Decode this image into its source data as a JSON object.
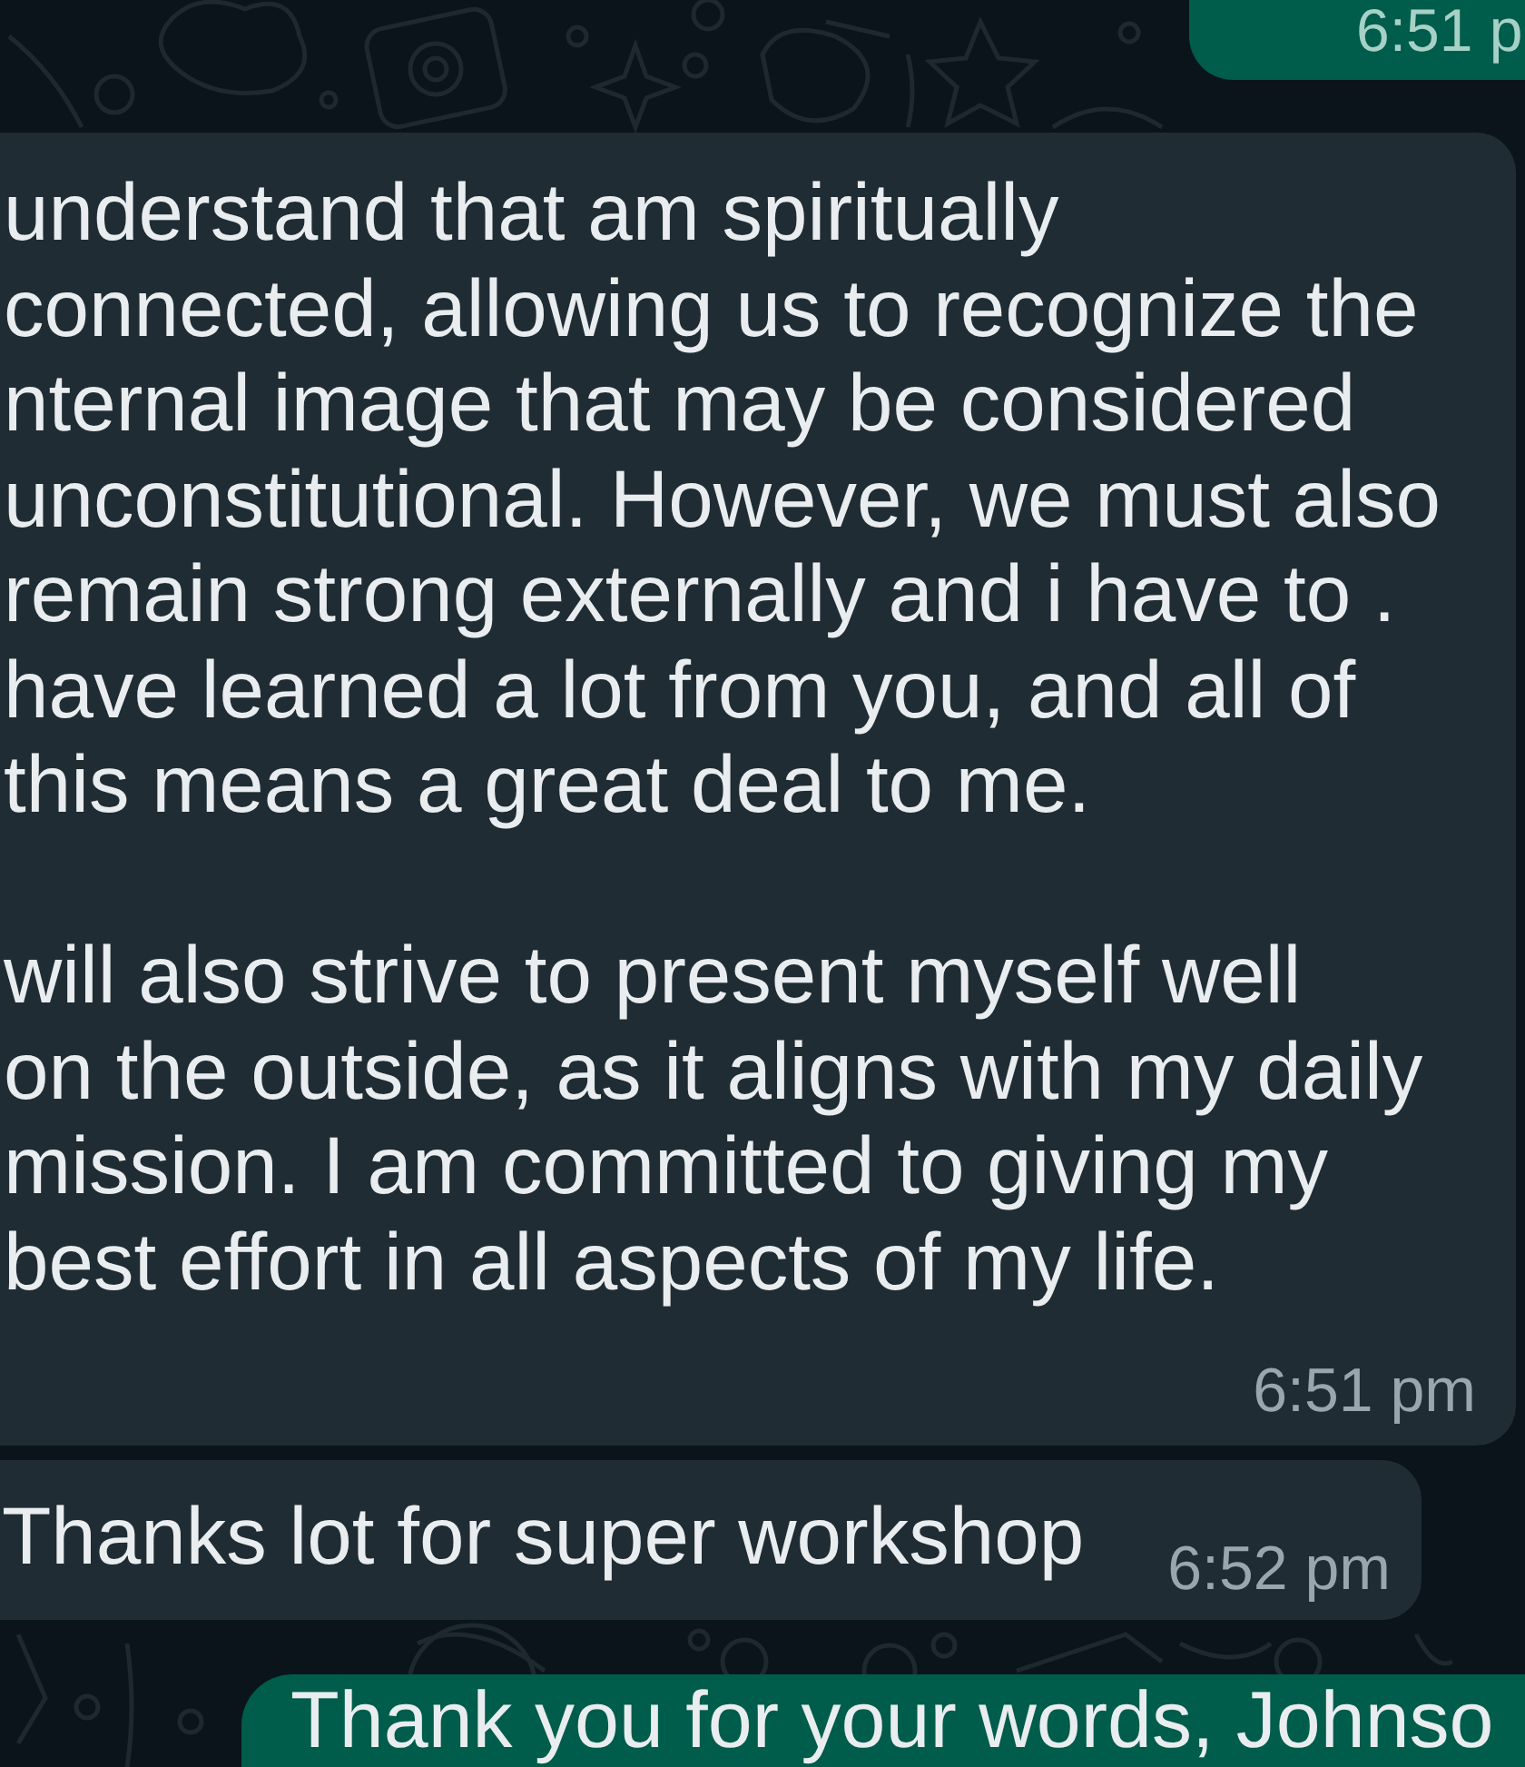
{
  "messages": [
    {
      "kind": "outgoing",
      "time": "6:51 p"
    },
    {
      "kind": "incoming",
      "text": "understand that am spiritually\nconnected, allowing us to recognize the\nnternal image that may be considered\nunconstitutional. However, we must also\nremain strong externally and i have to .\nhave learned a lot from you, and all of\nthis means a great deal to me.\n\nwill also strive to present myself well\non the outside, as it aligns with my daily\nmission. I am committed to giving my\nbest effort in all aspects of my life.",
      "time": "6:51 pm"
    },
    {
      "kind": "incoming",
      "text": "Thanks lot for super workshop",
      "time": "6:52 pm"
    },
    {
      "kind": "outgoing",
      "text": "Thank you for your words, Johnso"
    }
  ]
}
